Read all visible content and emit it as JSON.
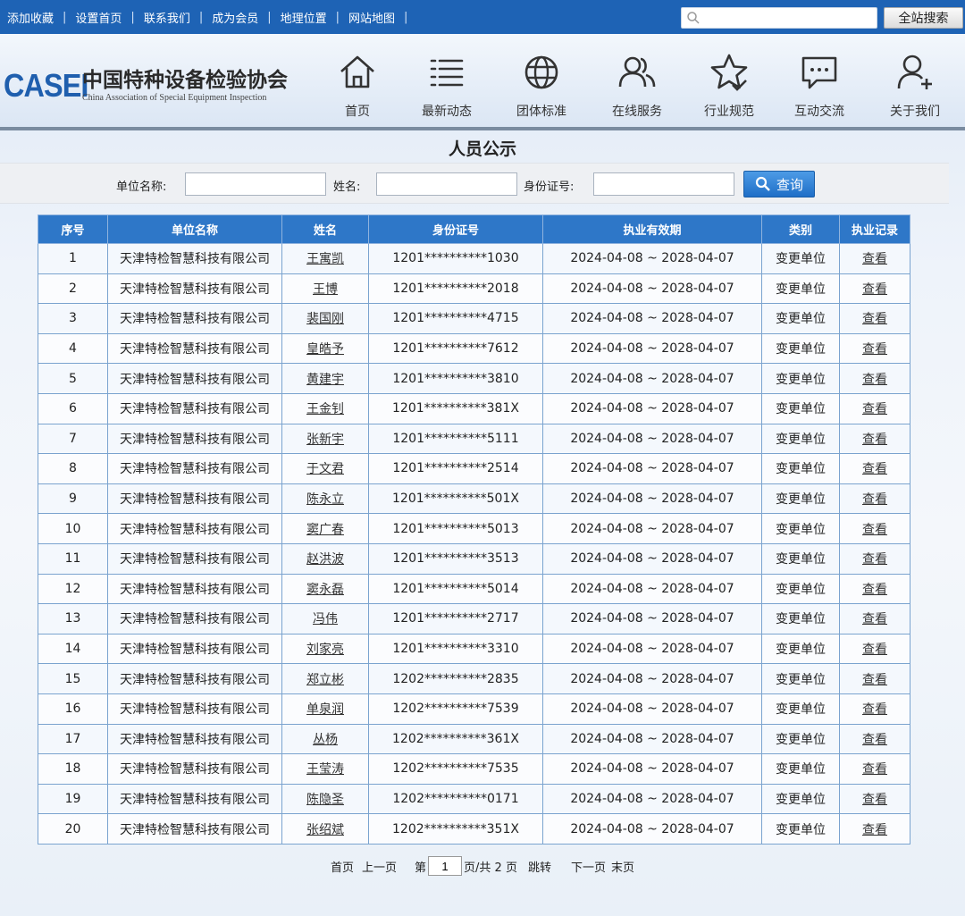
{
  "topbar": {
    "links": [
      "添加收藏",
      "设置首页",
      "联系我们",
      "成为会员",
      "地理位置",
      "网站地图"
    ],
    "search_placeholder": "",
    "search_button": "全站搜索"
  },
  "logo": {
    "mark": "CASEI",
    "cn": "中国特种设备检验协会",
    "en": "China Association of Special Equipment Inspection"
  },
  "nav": [
    {
      "label": "首页",
      "icon": "home-icon"
    },
    {
      "label": "最新动态",
      "icon": "news-list-icon"
    },
    {
      "label": "团体标准",
      "icon": "globe-icon"
    },
    {
      "label": "在线服务",
      "icon": "users-icon"
    },
    {
      "label": "行业规范",
      "icon": "star-icon"
    },
    {
      "label": "互动交流",
      "icon": "chat-icon"
    },
    {
      "label": "关于我们",
      "icon": "user-add-icon"
    }
  ],
  "page_title": "人员公示",
  "filters": {
    "unit_label": "单位名称:",
    "name_label": "姓名:",
    "id_label": "身份证号:",
    "unit_value": "",
    "name_value": "",
    "id_value": "",
    "query_button": "查询"
  },
  "table": {
    "headers": [
      "序号",
      "单位名称",
      "姓名",
      "身份证号",
      "执业有效期",
      "类别",
      "执业记录"
    ],
    "rows": [
      {
        "no": "1",
        "unit": "天津特检智慧科技有限公司",
        "name": "王寓凯",
        "id": "1201**********1030",
        "validity": "2024-04-08 ~ 2028-04-07",
        "category": "变更单位",
        "record": "查看"
      },
      {
        "no": "2",
        "unit": "天津特检智慧科技有限公司",
        "name": "王博",
        "id": "1201**********2018",
        "validity": "2024-04-08 ~ 2028-04-07",
        "category": "变更单位",
        "record": "查看"
      },
      {
        "no": "3",
        "unit": "天津特检智慧科技有限公司",
        "name": "裴国刚",
        "id": "1201**********4715",
        "validity": "2024-04-08 ~ 2028-04-07",
        "category": "变更单位",
        "record": "查看"
      },
      {
        "no": "4",
        "unit": "天津特检智慧科技有限公司",
        "name": "皇皓予",
        "id": "1201**********7612",
        "validity": "2024-04-08 ~ 2028-04-07",
        "category": "变更单位",
        "record": "查看"
      },
      {
        "no": "5",
        "unit": "天津特检智慧科技有限公司",
        "name": "黄建宇",
        "id": "1201**********3810",
        "validity": "2024-04-08 ~ 2028-04-07",
        "category": "变更单位",
        "record": "查看"
      },
      {
        "no": "6",
        "unit": "天津特检智慧科技有限公司",
        "name": "王金钊",
        "id": "1201**********381X",
        "validity": "2024-04-08 ~ 2028-04-07",
        "category": "变更单位",
        "record": "查看"
      },
      {
        "no": "7",
        "unit": "天津特检智慧科技有限公司",
        "name": "张新宇",
        "id": "1201**********5111",
        "validity": "2024-04-08 ~ 2028-04-07",
        "category": "变更单位",
        "record": "查看"
      },
      {
        "no": "8",
        "unit": "天津特检智慧科技有限公司",
        "name": "于文君",
        "id": "1201**********2514",
        "validity": "2024-04-08 ~ 2028-04-07",
        "category": "变更单位",
        "record": "查看"
      },
      {
        "no": "9",
        "unit": "天津特检智慧科技有限公司",
        "name": "陈永立",
        "id": "1201**********501X",
        "validity": "2024-04-08 ~ 2028-04-07",
        "category": "变更单位",
        "record": "查看"
      },
      {
        "no": "10",
        "unit": "天津特检智慧科技有限公司",
        "name": "窦广春",
        "id": "1201**********5013",
        "validity": "2024-04-08 ~ 2028-04-07",
        "category": "变更单位",
        "record": "查看"
      },
      {
        "no": "11",
        "unit": "天津特检智慧科技有限公司",
        "name": "赵洪波",
        "id": "1201**********3513",
        "validity": "2024-04-08 ~ 2028-04-07",
        "category": "变更单位",
        "record": "查看"
      },
      {
        "no": "12",
        "unit": "天津特检智慧科技有限公司",
        "name": "窦永磊",
        "id": "1201**********5014",
        "validity": "2024-04-08 ~ 2028-04-07",
        "category": "变更单位",
        "record": "查看"
      },
      {
        "no": "13",
        "unit": "天津特检智慧科技有限公司",
        "name": "冯伟",
        "id": "1201**********2717",
        "validity": "2024-04-08 ~ 2028-04-07",
        "category": "变更单位",
        "record": "查看"
      },
      {
        "no": "14",
        "unit": "天津特检智慧科技有限公司",
        "name": "刘家亮",
        "id": "1201**********3310",
        "validity": "2024-04-08 ~ 2028-04-07",
        "category": "变更单位",
        "record": "查看"
      },
      {
        "no": "15",
        "unit": "天津特检智慧科技有限公司",
        "name": "郑立彬",
        "id": "1202**********2835",
        "validity": "2024-04-08 ~ 2028-04-07",
        "category": "变更单位",
        "record": "查看"
      },
      {
        "no": "16",
        "unit": "天津特检智慧科技有限公司",
        "name": "单泉润",
        "id": "1202**********7539",
        "validity": "2024-04-08 ~ 2028-04-07",
        "category": "变更单位",
        "record": "查看"
      },
      {
        "no": "17",
        "unit": "天津特检智慧科技有限公司",
        "name": "丛杨",
        "id": "1202**********361X",
        "validity": "2024-04-08 ~ 2028-04-07",
        "category": "变更单位",
        "record": "查看"
      },
      {
        "no": "18",
        "unit": "天津特检智慧科技有限公司",
        "name": "王莹涛",
        "id": "1202**********7535",
        "validity": "2024-04-08 ~ 2028-04-07",
        "category": "变更单位",
        "record": "查看"
      },
      {
        "no": "19",
        "unit": "天津特检智慧科技有限公司",
        "name": "陈隐圣",
        "id": "1202**********0171",
        "validity": "2024-04-08 ~ 2028-04-07",
        "category": "变更单位",
        "record": "查看"
      },
      {
        "no": "20",
        "unit": "天津特检智慧科技有限公司",
        "name": "张绍斌",
        "id": "1202**********351X",
        "validity": "2024-04-08 ~ 2028-04-07",
        "category": "变更单位",
        "record": "查看"
      }
    ]
  },
  "pager": {
    "first": "首页",
    "prev": "上一页",
    "page_prefix": "第",
    "current_page": "1",
    "page_suffix": "页/共 2 页",
    "goto": "跳转",
    "next": "下一页",
    "last": "末页"
  },
  "colors": {
    "topbar": "#1e63b5",
    "table_header": "#2e77c8",
    "brand": "#1f5fae"
  }
}
